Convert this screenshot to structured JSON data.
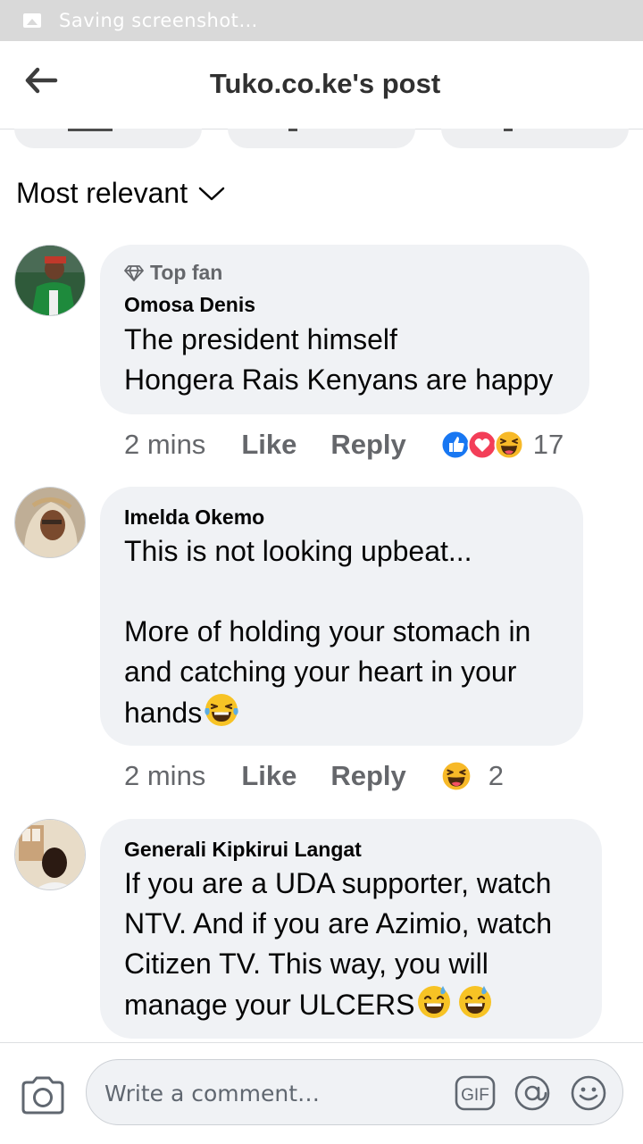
{
  "status_bar": {
    "text": "Saving screenshot…"
  },
  "header": {
    "title": "Tuko.co.ke's post"
  },
  "sort": {
    "label": "Most relevant"
  },
  "comments": [
    {
      "badge": "Top fan",
      "author": "Omosa Denis",
      "text": "The president himself\nHongera Rais Kenyans are happy",
      "time": "2 mins",
      "like": "Like",
      "reply": "Reply",
      "reactions": [
        "like",
        "love",
        "haha"
      ],
      "reaction_count": "17"
    },
    {
      "author": "Imelda Okemo",
      "text": "This is not looking upbeat...\n\nMore of holding your stomach in\nand catching your heart in your\nhands",
      "time": "2 mins",
      "like": "Like",
      "reply": "Reply",
      "reactions": [
        "haha"
      ],
      "reaction_count": "2"
    },
    {
      "author": "Generali Kipkirui Langat",
      "text": "If you are a UDA supporter, watch\nNTV. And if you are Azimio, watch\nCitizen TV. This way, you will\nmanage your ULCERS"
    }
  ],
  "composer": {
    "placeholder": "Write a comment…",
    "gif_label": "GIF"
  },
  "colors": {
    "like_blue": "#1877f2",
    "love_red": "#f33e58",
    "haha_yellow": "#f7b928",
    "meta_gray": "#65676b",
    "bubble": "#f0f2f5"
  }
}
